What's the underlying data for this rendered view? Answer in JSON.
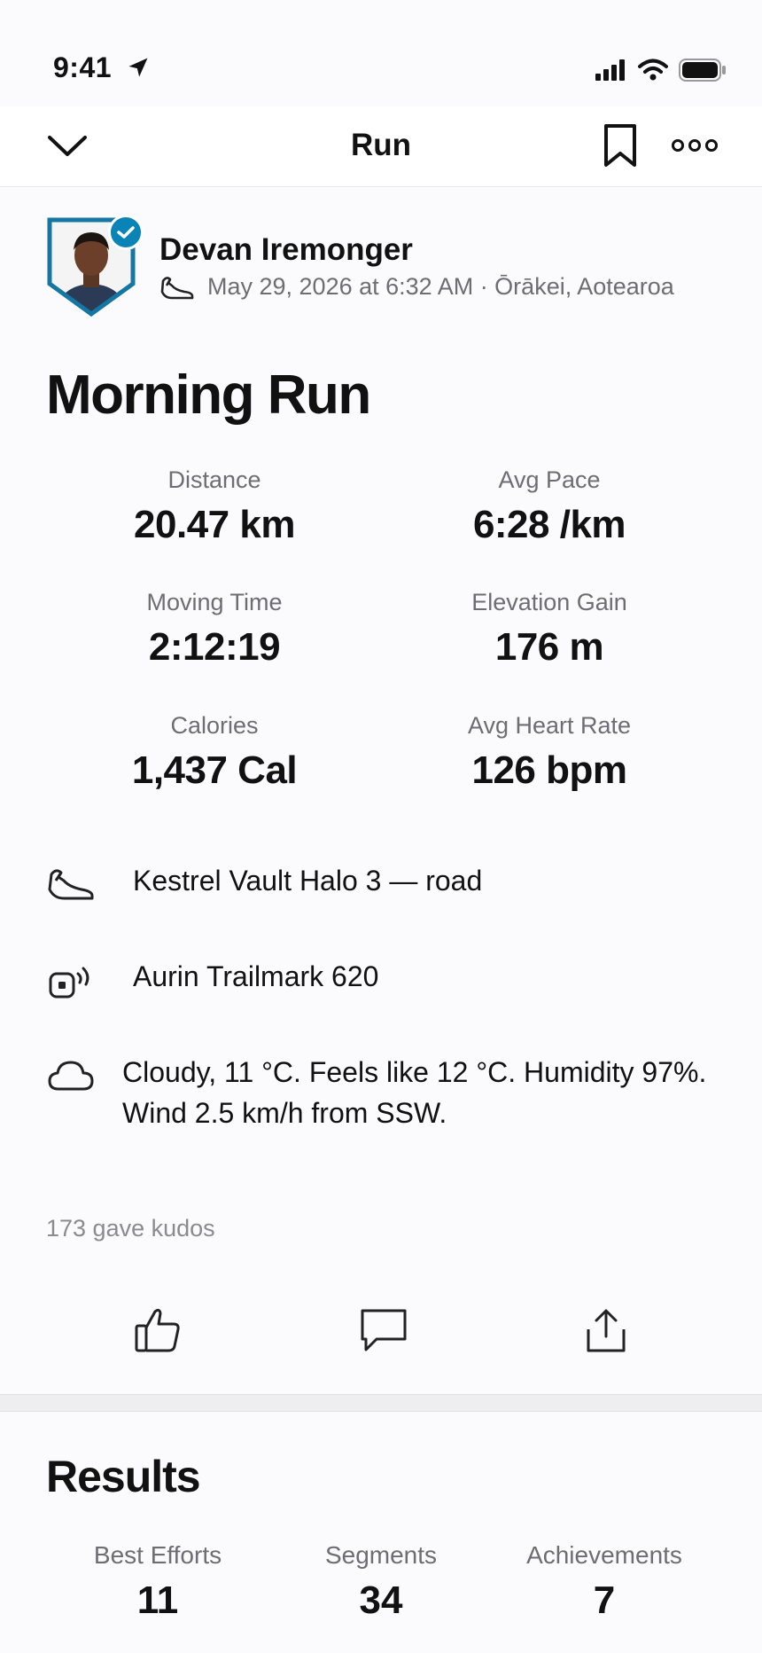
{
  "status": {
    "time": "9:41"
  },
  "nav": {
    "title": "Run"
  },
  "athlete": {
    "name": "Devan Iremonger",
    "meta": "May 29, 2026 at 6:32 AM · Ōrākei, Aotearoa"
  },
  "activity": {
    "title": "Morning Run"
  },
  "stats": [
    {
      "label": "Distance",
      "value": "20.47 km"
    },
    {
      "label": "Avg Pace",
      "value": "6:28 /km"
    },
    {
      "label": "Moving Time",
      "value": "2:12:19"
    },
    {
      "label": "Elevation Gain",
      "value": "176 m"
    },
    {
      "label": "Calories",
      "value": "1,437 Cal"
    },
    {
      "label": "Avg Heart Rate",
      "value": "126 bpm"
    }
  ],
  "details": {
    "shoe": "Kestrel Vault Halo 3 — road",
    "device": "Aurin Trailmark 620",
    "weather": "Cloudy, 11 °C. Feels like 12 °C. Humidity 97%. Wind 2.5 km/h from SSW."
  },
  "kudos": {
    "text": "173 gave kudos"
  },
  "results": {
    "title": "Results",
    "items": [
      {
        "label": "Best Efforts",
        "value": "11"
      },
      {
        "label": "Segments",
        "value": "34"
      },
      {
        "label": "Achievements",
        "value": "7"
      }
    ]
  },
  "icons": {
    "back": "chevron-down-icon",
    "bookmark": "bookmark-icon",
    "more": "more-icon",
    "shoe": "shoe-icon",
    "device": "device-icon",
    "weather": "cloud-icon",
    "kudos": "thumbs-up-icon",
    "comment": "comment-icon",
    "share": "share-icon"
  },
  "colors": {
    "accent": "#0a84b6",
    "muted": "#6d6d73"
  }
}
